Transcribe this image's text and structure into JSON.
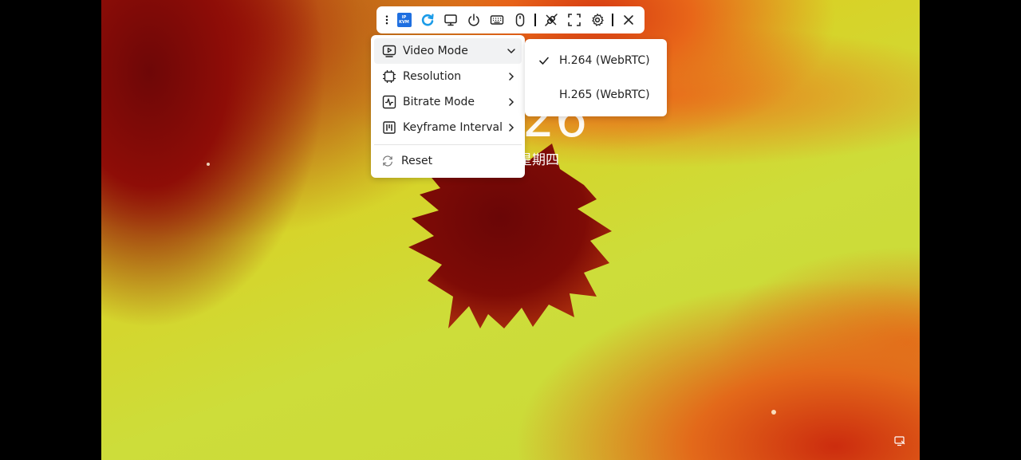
{
  "background": {
    "clock_fragment": "26",
    "date_fragment": "星期四"
  },
  "toolbar": {
    "items": [
      {
        "name": "drag-handle",
        "icon": "vertical-dots-icon"
      },
      {
        "name": "ipkvm-logo",
        "icon": "ipkvm-logo-icon",
        "text": [
          "IP",
          "KVM"
        ]
      },
      {
        "name": "reconnect-button",
        "icon": "refresh-icon",
        "color": "#1a9be8"
      },
      {
        "name": "video-button",
        "icon": "monitor-icon"
      },
      {
        "name": "power-button",
        "icon": "power-icon"
      },
      {
        "name": "keyboard-button",
        "icon": "keyboard-icon"
      },
      {
        "name": "mouse-button",
        "icon": "mouse-icon"
      },
      {
        "name": "network-button",
        "icon": "unplug-icon"
      },
      {
        "name": "fullscreen-button",
        "icon": "fullscreen-icon"
      },
      {
        "name": "settings-button",
        "icon": "gear-icon"
      },
      {
        "name": "close-button",
        "icon": "close-icon"
      }
    ]
  },
  "menu": {
    "items": [
      {
        "label": "Video Mode",
        "icon": "video-play-icon",
        "expanded": true
      },
      {
        "label": "Resolution",
        "icon": "resolution-icon"
      },
      {
        "label": "Bitrate Mode",
        "icon": "activity-icon"
      },
      {
        "label": "Keyframe Interval",
        "icon": "keyframe-icon"
      }
    ],
    "reset_label": "Reset"
  },
  "submenu": {
    "options": [
      {
        "label": "H.264 (WebRTC)",
        "selected": true
      },
      {
        "label": "H.265 (WebRTC)",
        "selected": false
      }
    ]
  }
}
